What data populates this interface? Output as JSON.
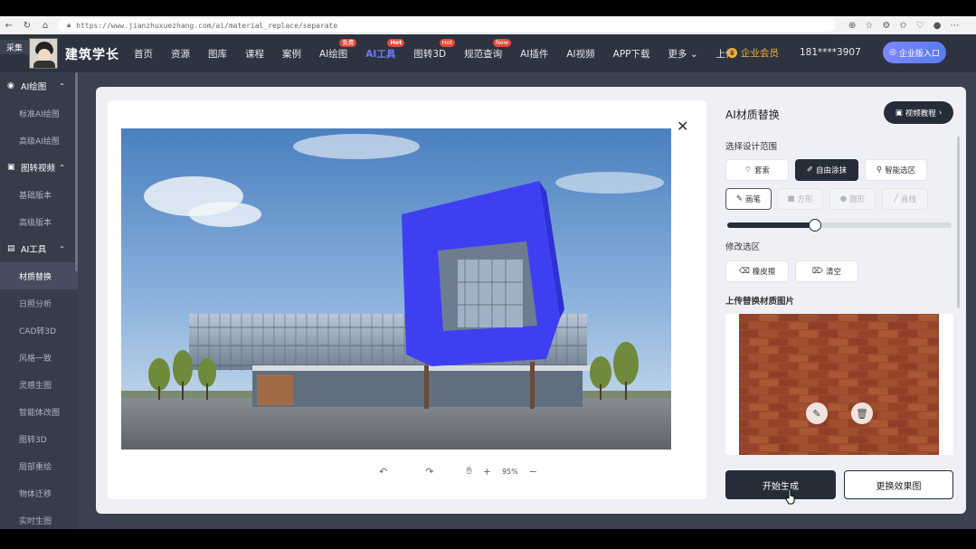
{
  "browser": {
    "url": "https://www.jianzhuxuezhang.com/ai/material_replace/separate",
    "nav_icons": [
      "back-icon",
      "refresh-icon",
      "home-icon"
    ],
    "right_icons": [
      "zoom-icon",
      "star-icon",
      "extension-icon",
      "favorites-icon",
      "shield-icon",
      "profile-icon",
      "more-icon"
    ]
  },
  "header": {
    "collect_label": "采集",
    "brand": "建筑学长",
    "nav": [
      {
        "label": "首页",
        "badge": ""
      },
      {
        "label": "资源",
        "badge": ""
      },
      {
        "label": "图库",
        "badge": ""
      },
      {
        "label": "课程",
        "badge": ""
      },
      {
        "label": "案例",
        "badge": ""
      },
      {
        "label": "AI绘图",
        "badge": "免费"
      },
      {
        "label": "AI工具",
        "badge": "Hot"
      },
      {
        "label": "图转3D",
        "badge": "Hot"
      },
      {
        "label": "规范查询",
        "badge": "New"
      },
      {
        "label": "AI插件",
        "badge": ""
      },
      {
        "label": "AI视频",
        "badge": ""
      },
      {
        "label": "APP下载",
        "badge": ""
      },
      {
        "label": "更多",
        "badge": ""
      },
      {
        "label": "上传",
        "badge": ""
      }
    ],
    "member_label": "企业会员",
    "phone": "181****3907",
    "enterprise_label": "企业版入口",
    "colors": {
      "bg": "#2d3340",
      "active": "#6e7cff",
      "badge": "#e24a3b",
      "member": "#f5b23a"
    }
  },
  "sidebar": {
    "groups": [
      {
        "label": "AI绘图",
        "icon": "palette-icon",
        "items": [
          "标准AI绘图",
          "高级AI绘图"
        ]
      },
      {
        "label": "图转视频",
        "icon": "video-icon",
        "items": [
          "基础版本",
          "高级版本"
        ]
      },
      {
        "label": "AI工具",
        "icon": "toolbox-icon",
        "items": [
          "材质替换",
          "日照分析",
          "CAD转3D",
          "风格一致",
          "灵感生图",
          "智能体改图",
          "图转3D",
          "局部重绘",
          "物体迁移",
          "实时生图"
        ]
      }
    ],
    "active_item": "材质替换"
  },
  "canvas": {
    "close_icon": "close-icon",
    "zoom_level": "95%",
    "tools": [
      "undo-icon",
      "redo-icon",
      "hand-icon",
      "zoom-in-icon",
      "zoom-out-icon"
    ]
  },
  "panel": {
    "title": "AI材质替换",
    "video_tutorial_label": "视频教程",
    "scope_label": "选择设计范围",
    "scope_buttons": [
      {
        "label": "套索",
        "icon": "lasso-icon",
        "selected": false
      },
      {
        "label": "自由涂抹",
        "icon": "brush-icon",
        "selected": true
      },
      {
        "label": "智能选区",
        "icon": "smart-select-icon",
        "selected": false
      }
    ],
    "brush_buttons": [
      {
        "label": "画笔",
        "icon": "pen-icon",
        "enabled": true
      },
      {
        "label": "方形",
        "icon": "square-icon",
        "enabled": false
      },
      {
        "label": "圆形",
        "icon": "circle-icon",
        "enabled": false
      },
      {
        "label": "直线",
        "icon": "line-icon",
        "enabled": false
      }
    ],
    "brush_size_fraction": 0.39,
    "modify_label": "修改选区",
    "modify_buttons": [
      {
        "label": "橡皮擦",
        "icon": "eraser-icon"
      },
      {
        "label": "清空",
        "icon": "clear-icon"
      }
    ],
    "upload_label": "上传替换材质图片",
    "texture_icons": [
      "edit-icon",
      "trash-icon"
    ],
    "generate_label": "开始生成",
    "swap_label": "更换效果图"
  }
}
